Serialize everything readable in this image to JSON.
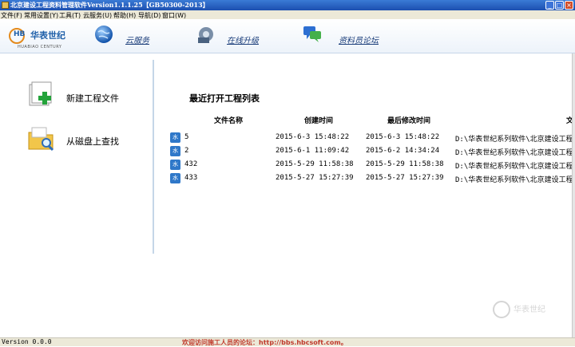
{
  "window": {
    "title": "北京建设工程资料管理软件Version1.1.1.25【GB50300-2013】",
    "min_label": "_",
    "max_label": "□",
    "close_label": "×"
  },
  "menu": {
    "items": [
      {
        "label": "文件(F)"
      },
      {
        "label": "常用设置(Y)"
      },
      {
        "label": "工具(T)"
      },
      {
        "label": "云服务(U)"
      },
      {
        "label": "帮助(H)"
      },
      {
        "label": "导航(D)"
      },
      {
        "label": "窗口(W)"
      }
    ]
  },
  "toolbar": {
    "logo_initials": "HB",
    "logo_cn": "华表世纪",
    "logo_en": "HUABIAO CENTURY",
    "cloud_label": "云服务",
    "upgrade_label": "在线升级",
    "forum_label": "资料员论坛"
  },
  "actions": {
    "new_project_label": "新建工程文件",
    "find_on_disk_label": "从磁盘上查找"
  },
  "recent": {
    "title": "最近打开工程列表",
    "columns": {
      "name": "文件名称",
      "created": "创建时间",
      "modified": "最后修改时间",
      "path": "文"
    },
    "rows": [
      {
        "icon": "水",
        "name": "5",
        "created": "2015-6-3 15:48:22",
        "modified": "2015-6-3 15:48:22",
        "path": "D:\\华表世纪系列软件\\北京建设工程"
      },
      {
        "icon": "水",
        "name": "2",
        "created": "2015-6-1 11:09:42",
        "modified": "2015-6-2 14:34:24",
        "path": "D:\\华表世纪系列软件\\北京建设工程"
      },
      {
        "icon": "水",
        "name": "432",
        "created": "2015-5-29 11:58:38",
        "modified": "2015-5-29 11:58:38",
        "path": "D:\\华表世纪系列软件\\北京建设工程"
      },
      {
        "icon": "水",
        "name": "433",
        "created": "2015-5-27 15:27:39",
        "modified": "2015-5-27 15:27:39",
        "path": "D:\\华表世纪系列软件\\北京建设工程"
      }
    ]
  },
  "status": {
    "version": "Version 0.0.0",
    "welcome": "欢迎访问施工人员的论坛：http://bbs.hbcsoft.com。"
  },
  "watermark": {
    "text": "华表世纪"
  },
  "colors": {
    "accent": "#1d5ea8",
    "titlebar": "#1c4fb0",
    "welcome_text": "#c0392b"
  }
}
